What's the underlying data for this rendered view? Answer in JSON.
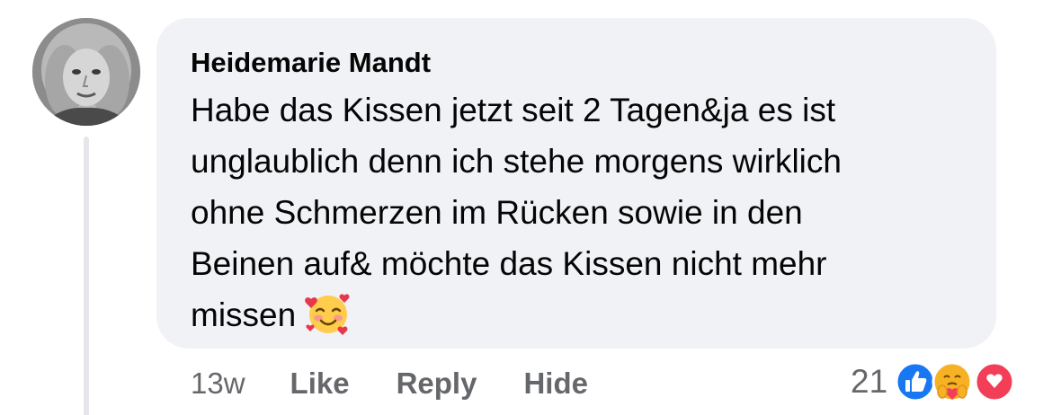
{
  "comment": {
    "author": "Heidemarie Mandt",
    "text": "Habe das Kissen jetzt seit 2 Tagen&ja es ist\nunglaublich denn ich stehe morgens wirklich\nohne Schmerzen im Rücken sowie in den\nBeinen auf& möchte das Kissen nicht mehr\nmissen",
    "emoji": "smiling-face-with-hearts"
  },
  "actions": {
    "time": "13w",
    "like": "Like",
    "reply": "Reply",
    "hide": "Hide"
  },
  "reactions": {
    "count": "21",
    "types": [
      "like",
      "care",
      "love"
    ],
    "colors": {
      "like": "#1877f2",
      "care": "#f7b125",
      "love": "#f33e58"
    }
  },
  "theme": {
    "bubble_bg": "#f0f2f5",
    "text": "#050505",
    "secondary_text": "#65676b"
  }
}
